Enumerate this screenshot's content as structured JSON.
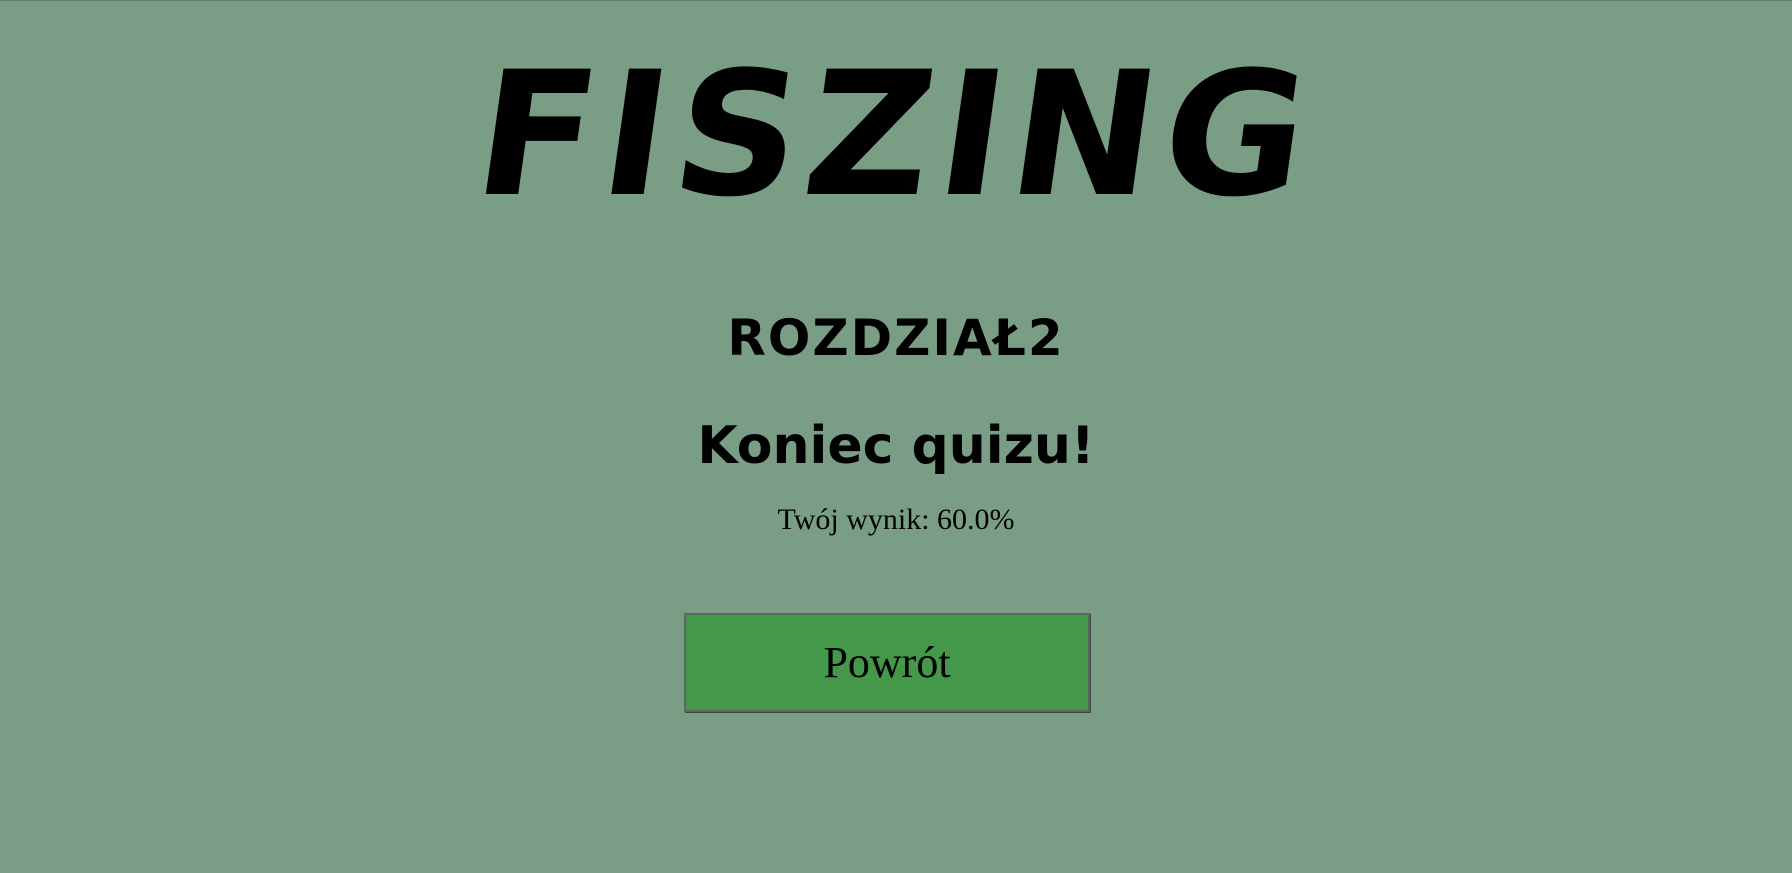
{
  "app": {
    "title": "FISZING"
  },
  "chapter": {
    "title": "ROZDZIAŁ2"
  },
  "quiz": {
    "end_heading": "Koniec quizu!",
    "score_text": "Twój wynik: 60.0%"
  },
  "actions": {
    "back_label": "Powrót"
  },
  "colors": {
    "background": "#7a9e85",
    "button": "#43984a"
  }
}
